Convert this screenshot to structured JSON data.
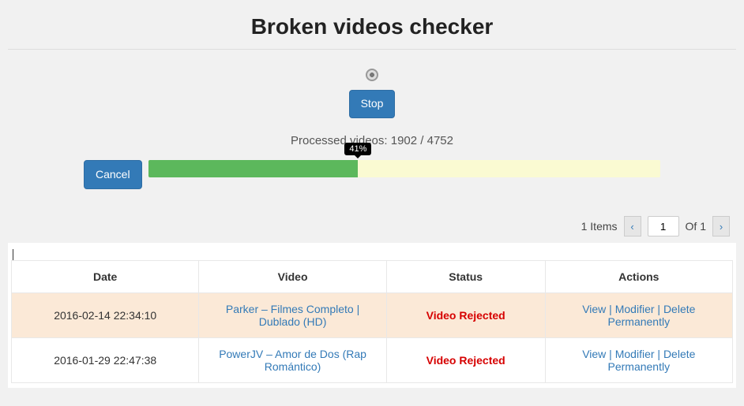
{
  "title": "Broken videos checker",
  "buttons": {
    "stop": "Stop",
    "cancel": "Cancel"
  },
  "progress": {
    "label_prefix": "Processed videos: ",
    "processed": 1902,
    "total": 4752,
    "percent": 41,
    "percent_label": "41%"
  },
  "pagination": {
    "items_count": 1,
    "items_label": "Items",
    "page": 1,
    "of_label": "Of",
    "total_pages": 1
  },
  "table": {
    "headers": {
      "date": "Date",
      "video": "Video",
      "status": "Status",
      "actions": "Actions"
    },
    "action_labels": {
      "view": "View",
      "edit": "Modifier",
      "delete": "Delete Permanently"
    },
    "rows": [
      {
        "date": "2016-02-14 22:34:10",
        "video": "Parker – Filmes Completo | Dublado (HD)",
        "status": "Video Rejected"
      },
      {
        "date": "2016-01-29 22:47:38",
        "video": "PowerJV – Amor de Dos (Rap Romántico)",
        "status": "Video Rejected"
      }
    ]
  }
}
